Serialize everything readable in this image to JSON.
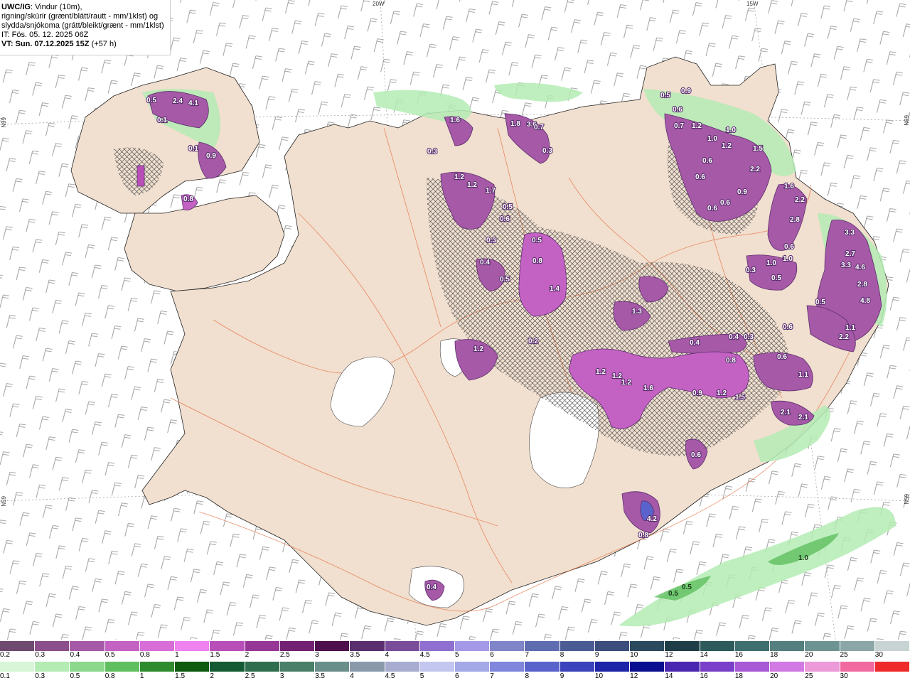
{
  "header": {
    "title_bold": "UWC/IG",
    "title_rest": ": Vindur (10m),",
    "line2": "rigning/skúrir (grænt/blátt/rautt - mm/1klst) og",
    "line3": "slydda/snjókoma (grátt/bleikt/grænt - mm/1klst)",
    "it": "IT: Fös. 05. 12. 2025 06Z",
    "vt_bold": "VT: Sun. 07.12.2025 15Z",
    "vt_rest": " (+57 h)"
  },
  "graticule": {
    "lon_top_1": "20W",
    "lon_top_2": "15W",
    "lat_left_1": "66N",
    "lat_left_2": "65N",
    "lat_right_1": "66N",
    "lat_right_2": "65N"
  },
  "snow_labels": [
    "2.4",
    "4.1",
    "0.5",
    "0.1",
    "0.1",
    "0.9",
    "0.8",
    "1.6",
    "0.3",
    "1.8",
    "3.6",
    "0.3",
    "0.7",
    "1.2",
    "1.2",
    "1.7",
    "0.5",
    "0.6",
    "0.3",
    "0.4",
    "0.5",
    "0.5",
    "0.8",
    "1.4",
    "0.5",
    "0.9",
    "0.6",
    "0.7",
    "1.2",
    "1.0",
    "1.0",
    "1.2",
    "1.5",
    "0.6",
    "2.2",
    "0.6",
    "0.9",
    "0.6",
    "0.6",
    "1.6",
    "2.2",
    "2.8",
    "0.6",
    "0.3",
    "1.0",
    "1.0",
    "0.5",
    "3.3",
    "2.7",
    "3.3",
    "4.6",
    "2.8",
    "4.8",
    "0.5",
    "1.1",
    "2.2",
    "0.6",
    "1.3",
    "1.2",
    "0.2",
    "0.4",
    "0.4",
    "0.3",
    "0.8",
    "0.6",
    "1.1",
    "1.2",
    "1.2",
    "1.2",
    "1.6",
    "0.9",
    "1.2",
    "1.5",
    "2.1",
    "2.1",
    "0.6",
    "4.2",
    "0.8",
    "0.4"
  ],
  "rain_labels": [
    "0.5",
    "0.5",
    "1.0"
  ],
  "legend": {
    "snow_ticks": [
      "0.2",
      "0.3",
      "0.4",
      "0.5",
      "0.8",
      "1",
      "1.5",
      "2",
      "2.5",
      "3",
      "3.5",
      "4",
      "4.5",
      "5",
      "6",
      "7",
      "8",
      "9",
      "10",
      "12",
      "14",
      "16",
      "18",
      "20",
      "25",
      "30"
    ],
    "snow_colors": [
      "#6e4a6e",
      "#8b4f8b",
      "#a659a6",
      "#c462c4",
      "#d86fd8",
      "#ee82ee",
      "#b84fb8",
      "#963696",
      "#732173",
      "#4d0f4d",
      "#5a2e6e",
      "#7a4d9b",
      "#8f6fcf",
      "#a399e6",
      "#7f85c8",
      "#5f6db0",
      "#4b5c94",
      "#3b4e7c",
      "#2b4a5e",
      "#1e3d46",
      "#2d5a5a",
      "#3f6e6e",
      "#557f7f",
      "#6e9393",
      "#8aa6a6",
      "#c8d4d4"
    ],
    "rain_ticks": [
      "0.1",
      "0.3",
      "0.5",
      "0.8",
      "1",
      "1.5",
      "2",
      "2.5",
      "3",
      "3.5",
      "4",
      "4.5",
      "5",
      "6",
      "7",
      "8",
      "9",
      "10",
      "12",
      "14",
      "16",
      "18",
      "20",
      "25",
      "30"
    ],
    "rain_colors": [
      "#d8f5d8",
      "#b4ecb4",
      "#8cd88c",
      "#5fbf5f",
      "#2e8b2e",
      "#0e5a0e",
      "#145a32",
      "#2e6e4e",
      "#4a7f6a",
      "#6a8f8a",
      "#8a99aa",
      "#a7acd0",
      "#c3c6ee",
      "#a3a8e6",
      "#7f86dc",
      "#5a62cc",
      "#3a43bb",
      "#1d24a8",
      "#0a0f8f",
      "#4a27b0",
      "#7a3fc8",
      "#a85ad6",
      "#d17ae3",
      "#ec9ad8",
      "#f06aa0",
      "#ee2a2a"
    ]
  }
}
